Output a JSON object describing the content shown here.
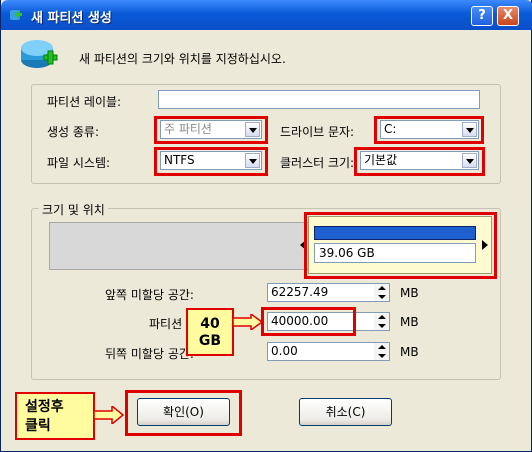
{
  "window": {
    "title": "새 파티션 생성",
    "help_label": "?",
    "close_label": "X",
    "header_text": "새 파티션의 크기와 위치를 지정하십시오."
  },
  "form": {
    "partition_label": {
      "label": "파티션 레이블:",
      "value": ""
    },
    "create_type": {
      "label": "생성 종류:",
      "value": "주 파티션"
    },
    "drive_letter": {
      "label": "드라이브 문자:",
      "value": "C:"
    },
    "file_system": {
      "label": "파일 시스템:",
      "value": "NTFS"
    },
    "cluster_size": {
      "label": "클러스터 크기:",
      "value": "기본값"
    }
  },
  "size_group": {
    "title": "크기 및 위치",
    "partition_display_size": "39.06 GB",
    "front_unallocated": {
      "label": "앞쪽 미할당 공간:",
      "value": "62257.49",
      "unit": "MB"
    },
    "partition_size": {
      "label": "파티션 크기:",
      "value": "40000.00",
      "unit": "MB"
    },
    "back_unallocated": {
      "label": "뒤쪽 미할당 공간:",
      "value": "0.00",
      "unit": "MB"
    }
  },
  "callouts": {
    "size_note": "40\nGB",
    "confirm_note": "설정후\n클릭"
  },
  "buttons": {
    "ok": "확인(O)",
    "cancel": "취소(C)"
  }
}
